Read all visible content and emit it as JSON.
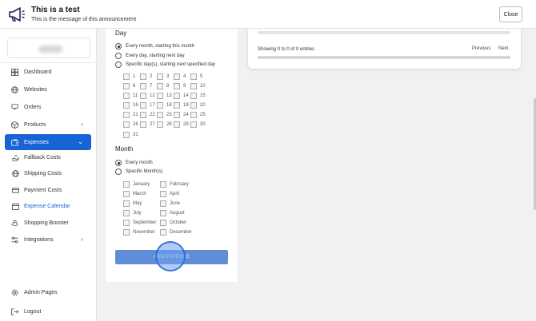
{
  "announcement": {
    "title": "This is a test",
    "message": "This is the message of this announcement",
    "close_label": "Close"
  },
  "sidebar": {
    "items": [
      {
        "label": "Dashboard",
        "icon": "dashboard-icon"
      },
      {
        "label": "Websites",
        "icon": "globe-icon"
      },
      {
        "label": "Orders",
        "icon": "orders-icon"
      },
      {
        "label": "Products",
        "icon": "box-icon"
      },
      {
        "label": "Expenses",
        "icon": "wallet-icon"
      }
    ],
    "sub_items": [
      {
        "label": "Fallback Costs",
        "icon": "hand-icon"
      },
      {
        "label": "Shipping Costs",
        "icon": "globe-icon"
      },
      {
        "label": "Payment Costs",
        "icon": "card-icon"
      },
      {
        "label": "Expense Calendar",
        "icon": "calendar-icon"
      }
    ],
    "items_after": [
      {
        "label": "Shopping Booster",
        "icon": "booster-icon"
      },
      {
        "label": "Integrations",
        "icon": "sliders-icon"
      }
    ],
    "bottom": [
      {
        "label": "Admin Pages",
        "icon": "gear-icon"
      },
      {
        "label": "Logout",
        "icon": "logout-icon"
      }
    ],
    "accent": "#1863d6"
  },
  "form": {
    "day_title": "Day",
    "day_options": [
      "Every month, starting this month",
      "Every day, starting next day",
      "Specific day(s), starting next specified day"
    ],
    "days": [
      "1",
      "2",
      "3",
      "4",
      "5",
      "6",
      "7",
      "8",
      "9",
      "10",
      "11",
      "12",
      "13",
      "14",
      "15",
      "16",
      "17",
      "18",
      "19",
      "20",
      "21",
      "22",
      "23",
      "24",
      "25",
      "26",
      "27",
      "28",
      "29",
      "30",
      "31"
    ],
    "month_title": "Month",
    "month_options": [
      "Every month",
      "Specific Month(s)"
    ],
    "months_left": [
      "January",
      "March",
      "May",
      "July",
      "September",
      "November"
    ],
    "months_right": [
      "February",
      "April",
      "June",
      "August",
      "October",
      "December"
    ],
    "add_label": "ADD EXPENSE"
  },
  "table": {
    "info": "Showing 0 to 0 of 0 entries",
    "previous": "Previous",
    "next": "Next"
  }
}
